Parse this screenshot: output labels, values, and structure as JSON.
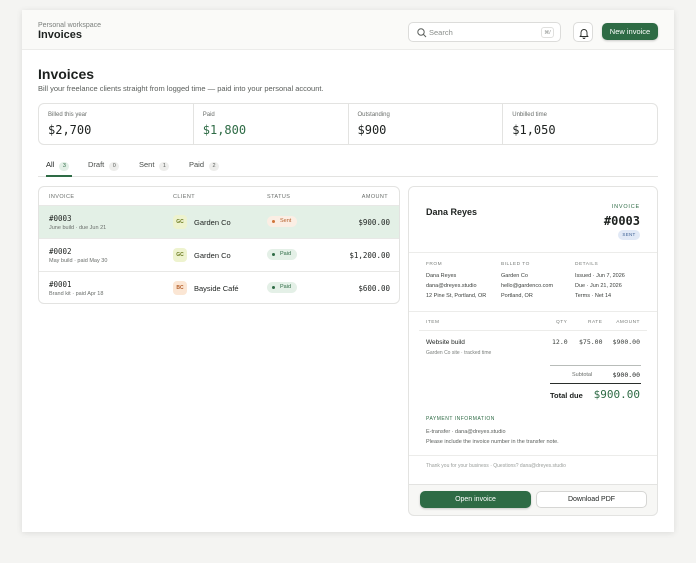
{
  "topbar": {
    "workspace_label": "Personal workspace",
    "workspace_title": "Invoices",
    "search_placeholder": "Search",
    "search_shortcut": "⌘/",
    "new_invoice_label": "New invoice"
  },
  "page": {
    "title": "Invoices",
    "subtitle": "Bill your freelance clients straight from logged time — paid into your personal account."
  },
  "stats": [
    {
      "label": "Billed this year",
      "value": "$2,700"
    },
    {
      "label": "Paid",
      "value": "$1,800"
    },
    {
      "label": "Outstanding",
      "value": "$900"
    },
    {
      "label": "Unbilled time",
      "value": "$1,050"
    }
  ],
  "tabs": [
    {
      "label": "All",
      "count": "3"
    },
    {
      "label": "Draft",
      "count": "0"
    },
    {
      "label": "Sent",
      "count": "1"
    },
    {
      "label": "Paid",
      "count": "2"
    }
  ],
  "table": {
    "headers": {
      "invoice": "INVOICE",
      "client": "CLIENT",
      "status": "STATUS",
      "amount": "AMOUNT"
    },
    "rows": [
      {
        "id": "#0003",
        "sub": "June build · due Jun 21",
        "initials": "GC",
        "client": "Garden Co",
        "status": "Sent",
        "amount": "$900.00"
      },
      {
        "id": "#0002",
        "sub": "May build · paid May 30",
        "initials": "GC",
        "client": "Garden Co",
        "status": "Paid",
        "amount": "$1,200.00"
      },
      {
        "id": "#0001",
        "sub": "Brand kit · paid Apr 18",
        "initials": "BC",
        "client": "Bayside Café",
        "status": "Paid",
        "amount": "$600.00"
      }
    ]
  },
  "preview": {
    "from_name": "Dana Reyes",
    "invoice_label": "INVOICE",
    "invoice_number": "#0003",
    "status": "SENT",
    "from": {
      "heading": "FROM",
      "lines": [
        "Dana Reyes",
        "dana@dreyes.studio",
        "12 Pine St, Portland, OR"
      ]
    },
    "billed_to": {
      "heading": "BILLED TO",
      "lines": [
        "Garden Co",
        "hello@gardenco.com",
        "Portland, OR"
      ]
    },
    "details": {
      "heading": "DETAILS",
      "lines": [
        "Issued · Jun 7, 2026",
        "Due · Jun 21, 2026",
        "Terms · Net 14"
      ]
    },
    "items_headers": {
      "item": "ITEM",
      "qty": "QTY",
      "rate": "RATE",
      "amount": "AMOUNT"
    },
    "item": {
      "name": "Website build",
      "sub": "Garden Co site · tracked time",
      "qty": "12.0",
      "rate": "$75.00",
      "amount": "$900.00"
    },
    "subtotal_label": "Subtotal",
    "subtotal_value": "$900.00",
    "total_label": "Total due",
    "total_value": "$900.00",
    "payment_heading": "PAYMENT INFORMATION",
    "payment_lines": [
      "E-transfer · dana@dreyes.studio",
      "Please include the invoice number in the transfer note."
    ],
    "thanks": "Thank you for your business · Questions? dana@dreyes.studio",
    "open_label": "Open invoice",
    "download_label": "Download PDF"
  },
  "colors": {
    "accent": "#2e6b45",
    "selected_row": "#e3f0e6",
    "sent": "#d0753a"
  }
}
